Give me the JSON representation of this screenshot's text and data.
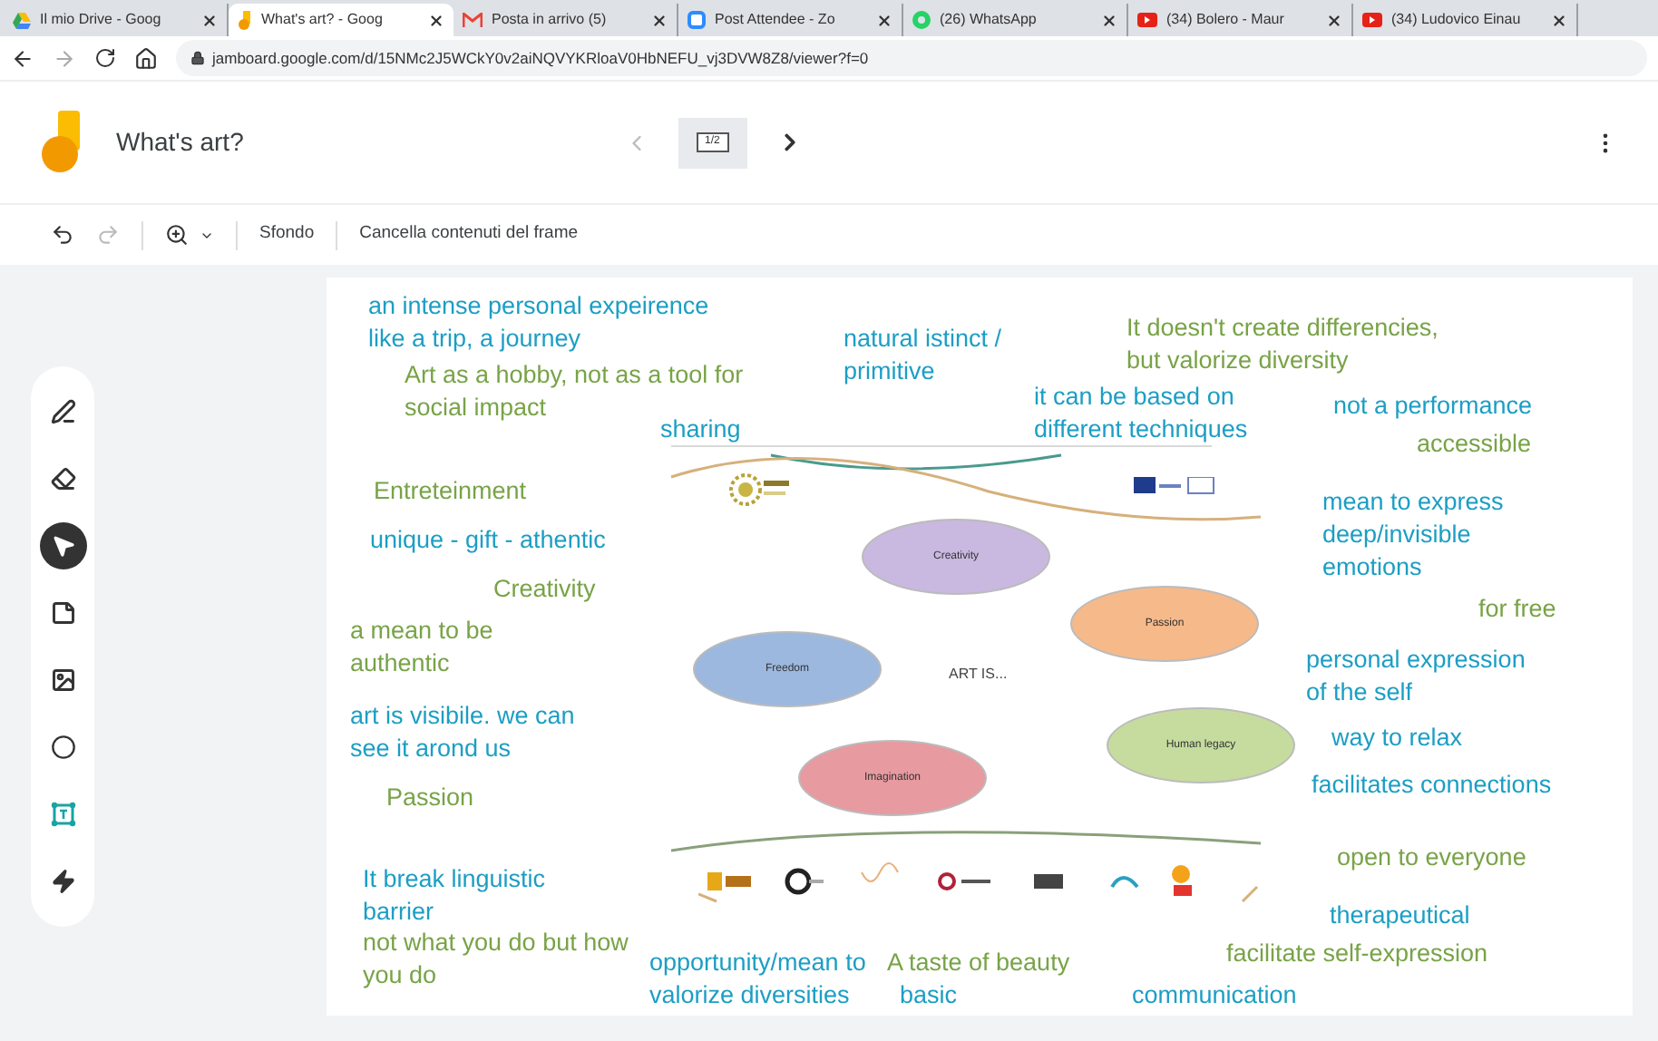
{
  "browser": {
    "tabs": [
      {
        "title": "Il mio Drive - Goog",
        "kind": "drive",
        "selected": false
      },
      {
        "title": "What's art? - Goog",
        "kind": "jamboard",
        "selected": true
      },
      {
        "title": "Posta in arrivo (5)",
        "kind": "mail",
        "selected": false
      },
      {
        "title": "Post Attendee - Zo",
        "kind": "zoom",
        "selected": false
      },
      {
        "title": "(26) WhatsApp",
        "kind": "whatsapp",
        "selected": false
      },
      {
        "title": "(34) Bolero - Maur",
        "kind": "video",
        "selected": false
      },
      {
        "title": "(34) Ludovico Einau",
        "kind": "video",
        "selected": false
      }
    ],
    "url": "jamboard.google.com/d/15NMc2J5WCkY0v2aiNQVYKRloaV0HbNEFU_vj3DVW8Z8/viewer?f=0"
  },
  "app": {
    "title": "What's art?",
    "frame_indicator": "1/2"
  },
  "toolbar": {
    "buttons": [
      "Sfondo",
      "Cancella contenuti del frame"
    ]
  },
  "tools": [
    {
      "kind": "pen",
      "selected": false
    },
    {
      "kind": "eraser",
      "selected": false
    },
    {
      "kind": "select",
      "selected": true
    },
    {
      "kind": "note",
      "selected": false
    },
    {
      "kind": "image",
      "selected": false
    },
    {
      "kind": "shape",
      "selected": false
    },
    {
      "kind": "textbox",
      "selected": false
    },
    {
      "kind": "laser",
      "selected": false
    }
  ],
  "image": {
    "caption": "ART IS...",
    "ovals": [
      {
        "label": "Creativity",
        "color": "#c9b8e0"
      },
      {
        "label": "Passion",
        "color": "#f6b98a"
      },
      {
        "label": "Freedom",
        "color": "#9cb8de"
      },
      {
        "label": "Human legacy",
        "color": "#c6dc9e"
      },
      {
        "label": "Imagination",
        "color": "#e79aa0"
      }
    ]
  },
  "notes": [
    {
      "text": "an intense personal expeirence\nlike a trip, a journey",
      "color": "#1c9ec4"
    },
    {
      "text": "Art as a hobby, not as a tool for\nsocial impact",
      "color": "#78a347"
    },
    {
      "text": "sharing",
      "color": "#1c9ec4"
    },
    {
      "text": "natural istinct /\nprimitive",
      "color": "#1c9ec4"
    },
    {
      "text": "It doesn't create differencies,\nbut valorize diversity",
      "color": "#78a347"
    },
    {
      "text": "it can be based on\ndifferent techniques",
      "color": "#1c9ec4"
    },
    {
      "text": "not a performance",
      "color": "#1c9ec4"
    },
    {
      "text": "accessible",
      "color": "#78a347"
    },
    {
      "text": "Entreteinment",
      "color": "#78a347"
    },
    {
      "text": "unique - gift - athentic",
      "color": "#1c9ec4"
    },
    {
      "text": "Creativity",
      "color": "#78a347"
    },
    {
      "text": "a mean to be\nauthentic",
      "color": "#78a347"
    },
    {
      "text": "art is visibile. we can\nsee it arond us",
      "color": "#1c9ec4"
    },
    {
      "text": "Passion",
      "color": "#78a347"
    },
    {
      "text": "It break linguistic\nbarrier",
      "color": "#1c9ec4"
    },
    {
      "text": "not what you do but how\nyou do",
      "color": "#78a347"
    },
    {
      "text": "opportunity/mean to\nvalorize diversities",
      "color": "#1c9ec4"
    },
    {
      "text": "A taste of beauty",
      "color": "#78a347"
    },
    {
      "text": "basic",
      "color": "#1c9ec4"
    },
    {
      "text": "mean to express\ndeep/invisible\nemotions",
      "color": "#1c9ec4"
    },
    {
      "text": "for free",
      "color": "#78a347"
    },
    {
      "text": "personal expression\nof the self",
      "color": "#1c9ec4"
    },
    {
      "text": "way to relax",
      "color": "#1c9ec4"
    },
    {
      "text": "facilitates connections",
      "color": "#1c9ec4"
    },
    {
      "text": "open to everyone",
      "color": "#78a347"
    },
    {
      "text": "therapeutical",
      "color": "#1c9ec4"
    },
    {
      "text": "facilitate self-expression",
      "color": "#78a347"
    },
    {
      "text": "communication",
      "color": "#1c9ec4"
    }
  ]
}
